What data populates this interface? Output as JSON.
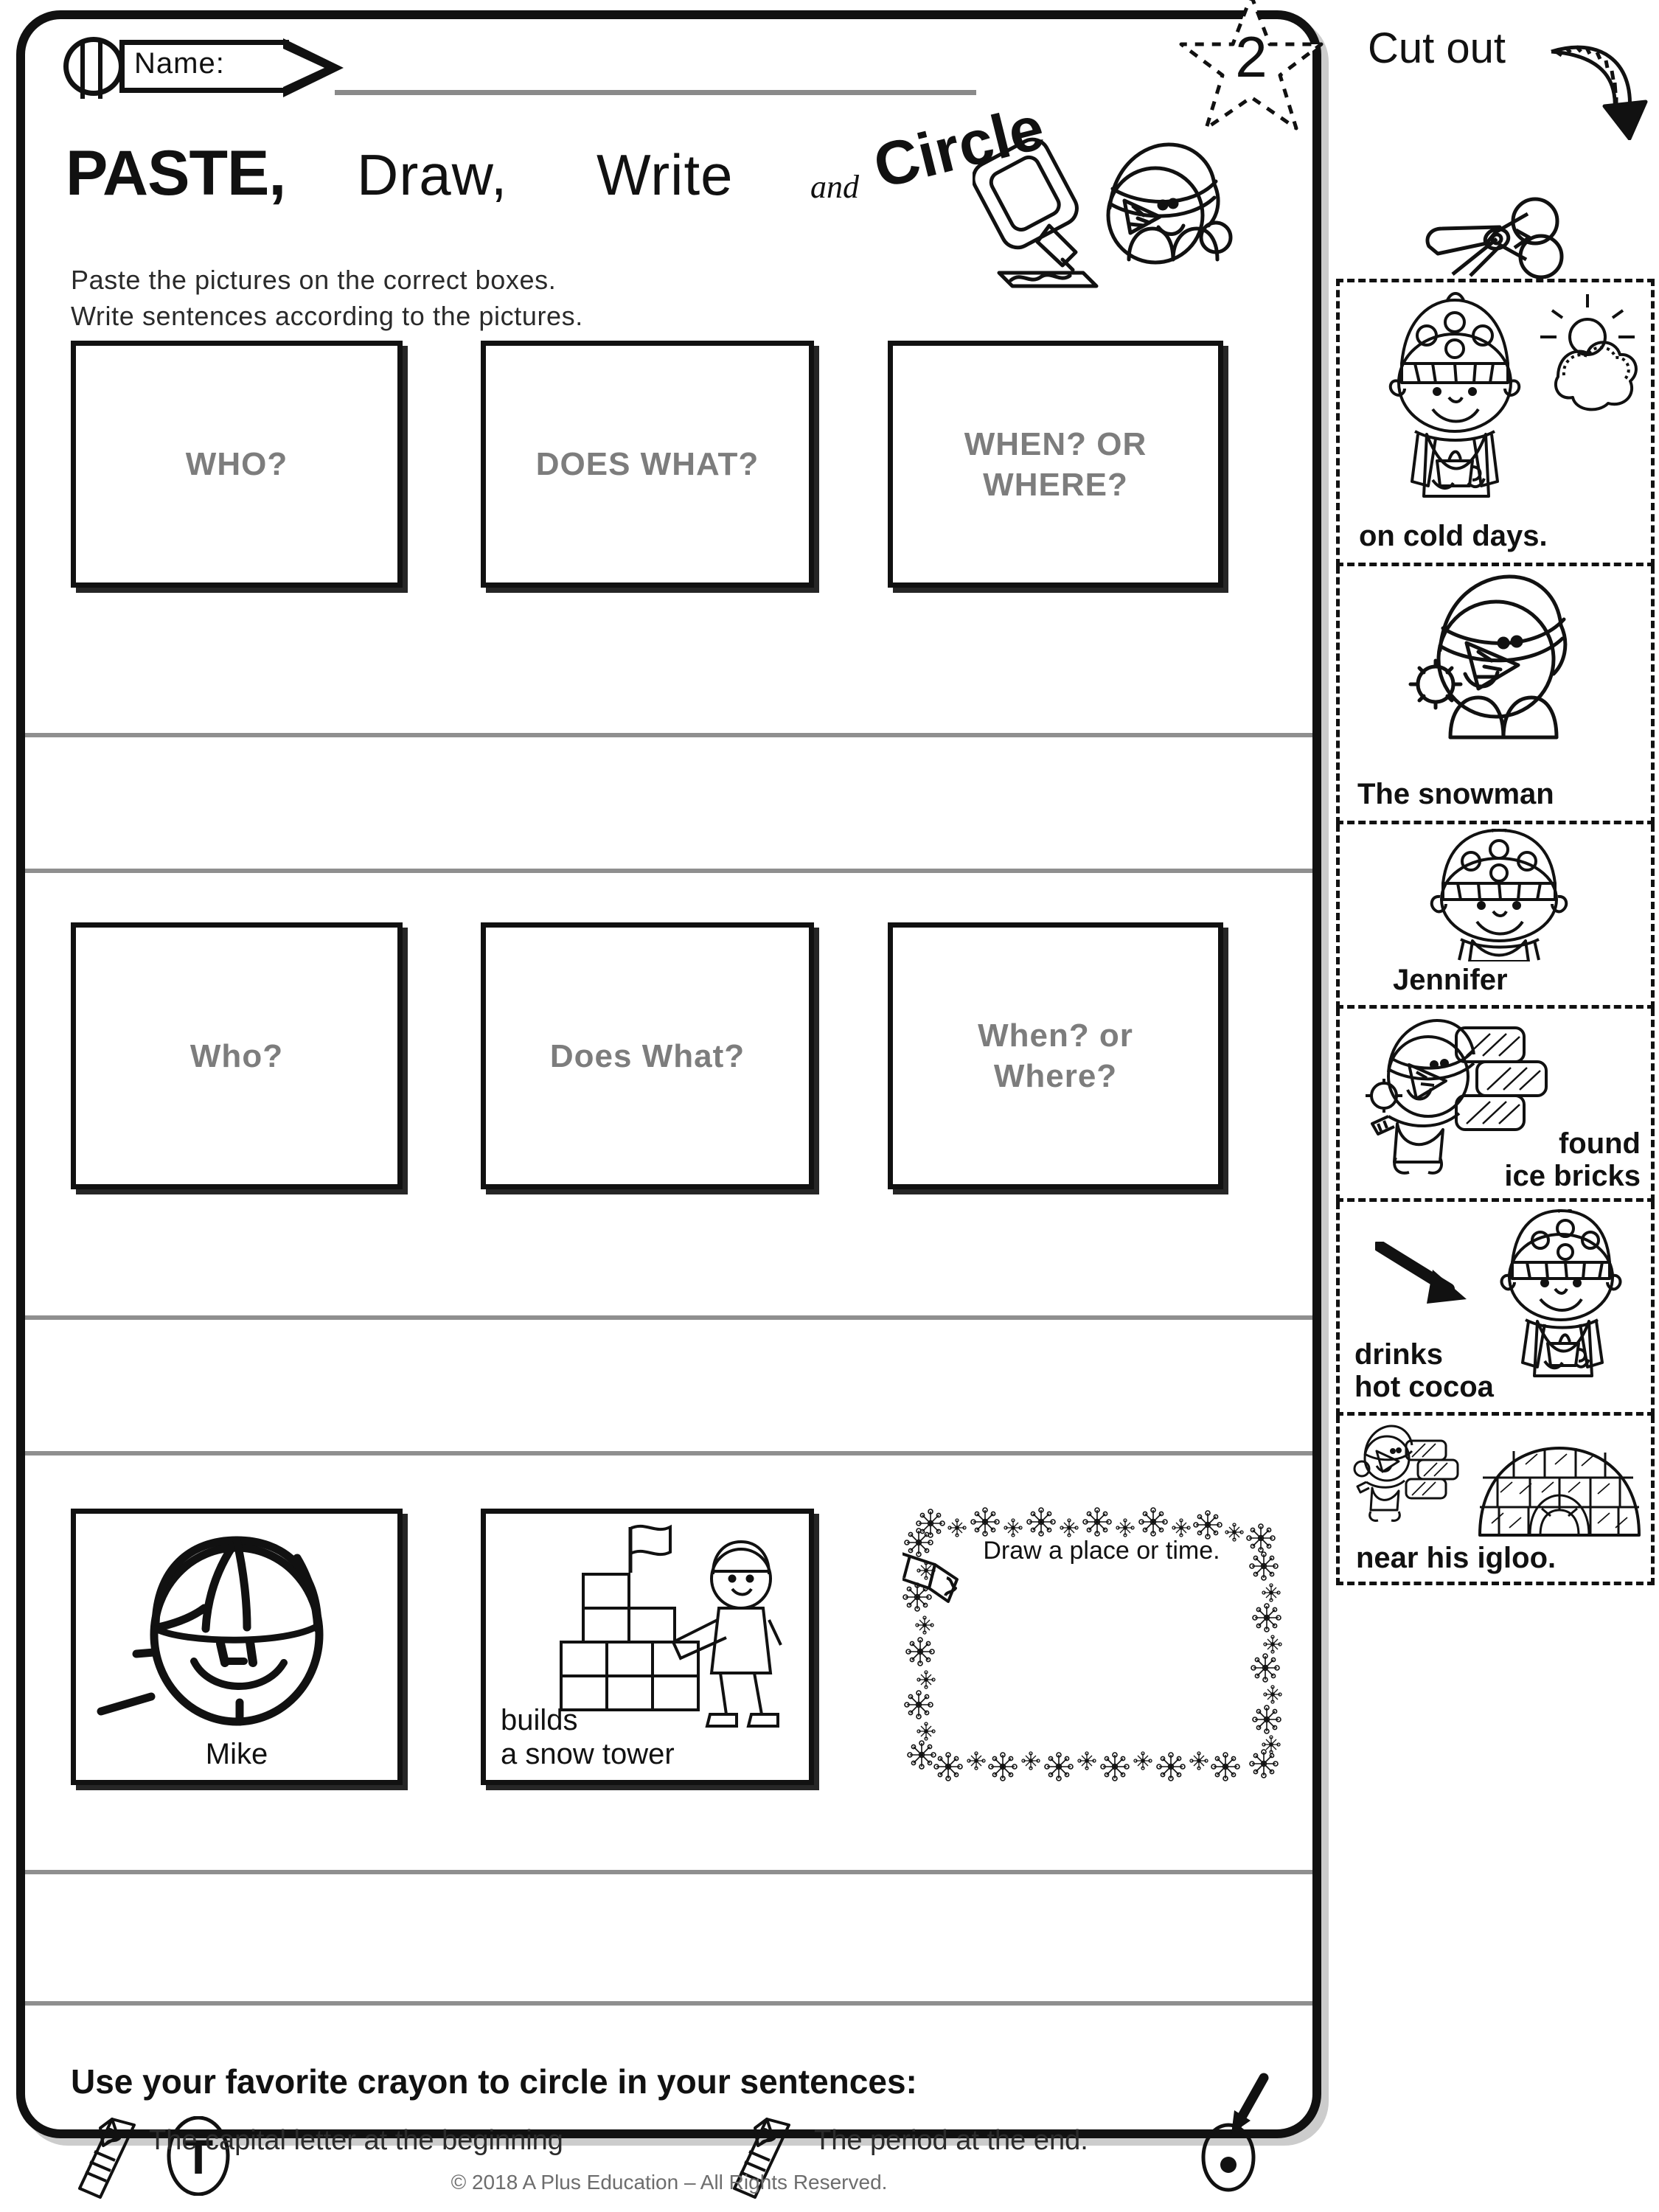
{
  "page": {
    "badge_number": "2",
    "name_label": "Name:",
    "copyright": "© 2018 A Plus Education – All Rights Reserved."
  },
  "title": {
    "word1": "PASTE,",
    "word2": "Draw,",
    "word3": "Write",
    "connector": "and",
    "word4": "Circle"
  },
  "directions": {
    "line1": "Paste the pictures on the correct boxes.",
    "line2": "Write sentences according to the pictures."
  },
  "rows": [
    {
      "name": "row-1-prompts",
      "boxes": [
        {
          "label": "WHO?"
        },
        {
          "label": "DOES WHAT?"
        },
        {
          "label": "WHEN? OR\nWHERE?"
        }
      ]
    },
    {
      "name": "row-2-prompts",
      "boxes": [
        {
          "label": "Who?"
        },
        {
          "label": "Does What?"
        },
        {
          "label": "When? or\nWhere?"
        }
      ]
    },
    {
      "name": "row-3-example",
      "boxes": [
        {
          "label": "Mike"
        },
        {
          "label": "builds\na snow tower"
        },
        {
          "label": "Draw a place or time."
        }
      ]
    }
  ],
  "cutout": {
    "heading": "Cut out",
    "cards": [
      {
        "text": "on cold days.",
        "icon": "girl-with-cocoa-and-sun-cloud"
      },
      {
        "text": "The snowman",
        "icon": "snowman-with-santa-hat"
      },
      {
        "text": "Jennifer",
        "icon": "girl-with-polka-dot-hat"
      },
      {
        "text": "found\nice bricks",
        "icon": "snowman-carrying-ice-bricks"
      },
      {
        "text": "drinks\nhot cocoa",
        "icon": "girl-drinking-cocoa-with-arrow"
      },
      {
        "text": "near his igloo.",
        "icon": "snowman-and-igloo"
      }
    ]
  },
  "bottom": {
    "title": "Use your favorite crayon to circle in your sentences:",
    "item1": "The capital letter at the beginning",
    "item2": "The period at the end.",
    "capital_letter": "T"
  }
}
